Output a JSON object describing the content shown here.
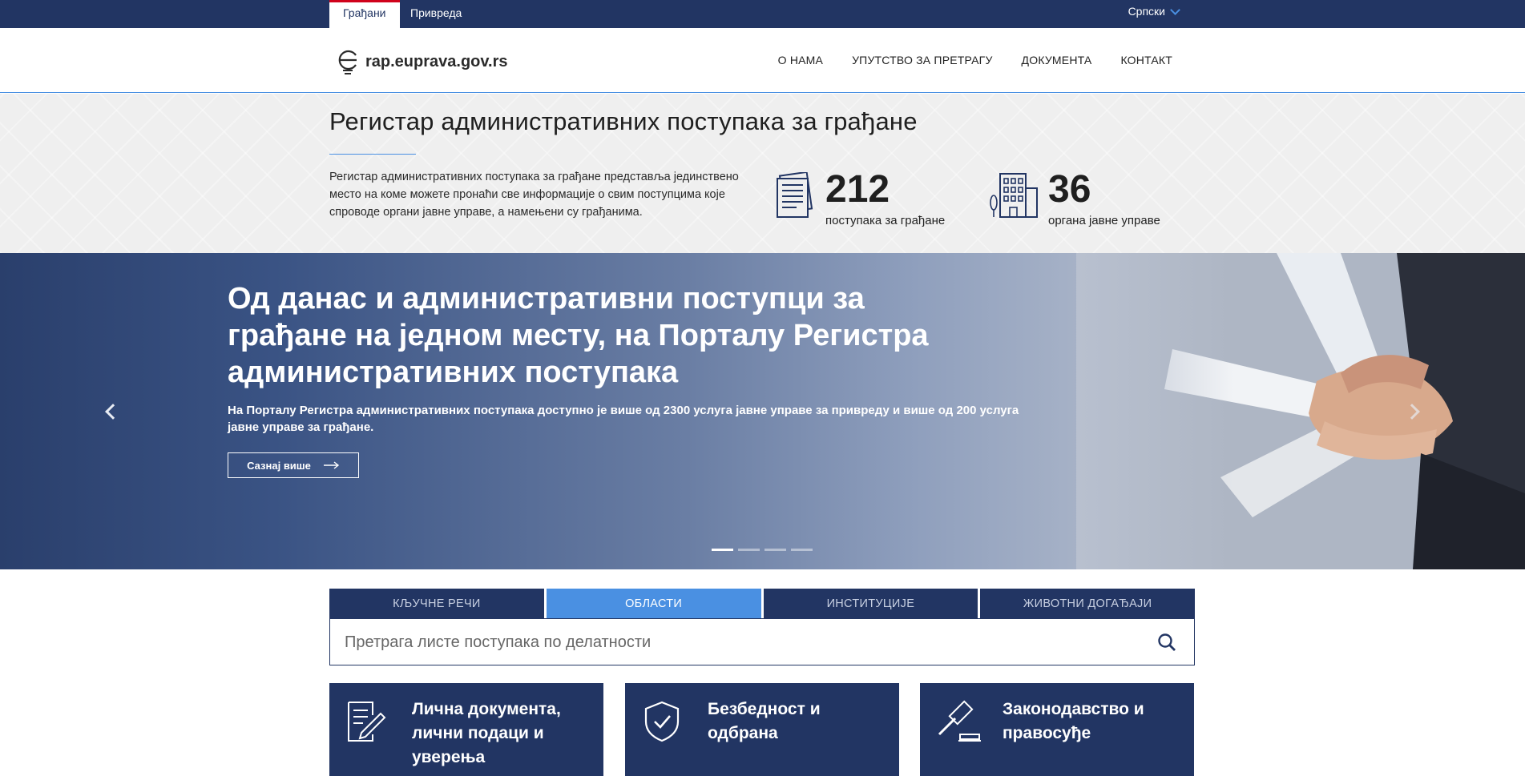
{
  "topbar": {
    "tabs": [
      {
        "label": "Грађани",
        "active": true
      },
      {
        "label": "Привреда",
        "active": false
      }
    ],
    "language": "Српски"
  },
  "header": {
    "logo_text": "rap.euprava.gov.rs",
    "nav": [
      "О НАМА",
      "УПУТСТВО ЗА ПРЕТРАГУ",
      "ДОКУМЕНТА",
      "КОНТАКТ"
    ]
  },
  "intro": {
    "title": "Регистар административних поступака за грађане",
    "description": "Регистар административних поступака за грађане представља јединствено место на коме можете пронаћи све информације о свим поступцима које спроводе органи јавне управе, а намењени су грађанима.",
    "stats": [
      {
        "value": "212",
        "label": "поступака за грађане",
        "icon": "documents-icon"
      },
      {
        "value": "36",
        "label": "органа јавне управе",
        "icon": "building-icon"
      }
    ]
  },
  "hero": {
    "heading": "Од данас и административни поступци за грађане на једном месту, на Порталу Регистра административних поступака",
    "text": "На Порталу Регистра административних поступака доступно је више од 2300 услуга јавне управе за привреду и више од 200 услуга јавне управе за грађане.",
    "button_label": "Сазнај више",
    "slides_total": 4,
    "active_slide": 1
  },
  "search": {
    "tabs": [
      {
        "label": "КЉУЧНЕ РЕЧИ",
        "active": false
      },
      {
        "label": "ОБЛАСТИ",
        "active": true
      },
      {
        "label": "ИНСТИТУЦИЈЕ",
        "active": false
      },
      {
        "label": "ЖИВОТНИ ДОГАЂАЈИ",
        "active": false
      }
    ],
    "placeholder": "Претрага листе поступака по делатности",
    "value": ""
  },
  "categories": [
    {
      "title": "Лична документа, лични подаци и уверења",
      "icon": "document-edit-icon"
    },
    {
      "title": "Безбедност и одбрана",
      "icon": "shield-check-icon"
    },
    {
      "title": "Законодавство и правосуђе",
      "icon": "gavel-icon"
    }
  ],
  "colors": {
    "primary": "#223563",
    "accent": "#4a90e2",
    "active_tab_marker": "#d0021b",
    "intro_bg": "#efefef"
  }
}
